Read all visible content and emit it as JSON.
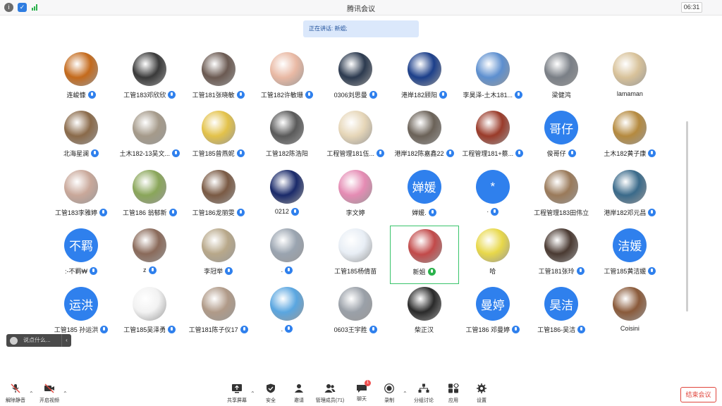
{
  "window": {
    "title": "腾讯会议",
    "clock": "06:31"
  },
  "speaking": {
    "text": "正在讲话: 新姐;"
  },
  "participants": [
    {
      "name": "连峻慷",
      "avatar_color": "#c46a1c",
      "avatar_text": "",
      "mic": "blue"
    },
    {
      "name": "工管183邓欣欣",
      "avatar_color": "#3a3a3a",
      "avatar_text": "",
      "mic": "blue"
    },
    {
      "name": "工管181张晓敏",
      "avatar_color": "#6b5a52",
      "avatar_text": "",
      "mic": "blue"
    },
    {
      "name": "工管182许敏珊",
      "avatar_color": "#e9b9a4",
      "avatar_text": "",
      "mic": "blue"
    },
    {
      "name": "0306刘思曼",
      "avatar_color": "#2c3a4f",
      "avatar_text": "",
      "mic": "blue"
    },
    {
      "name": "港岸182顾阳",
      "avatar_color": "#1c3f8a",
      "avatar_text": "",
      "mic": "blue"
    },
    {
      "name": "李昊泽-土木181...",
      "avatar_color": "#5d8fcf",
      "avatar_text": "",
      "mic": "blue"
    },
    {
      "name": "梁健鸿",
      "avatar_color": "#7a7f86",
      "avatar_text": "",
      "mic": "none"
    },
    {
      "name": "lamaman",
      "avatar_color": "#d8c29a",
      "avatar_text": "",
      "mic": "none"
    },
    {
      "name": "北海星澜",
      "avatar_color": "#8a6a4a",
      "avatar_text": "",
      "mic": "blue"
    },
    {
      "name": "土木182-13吴文...",
      "avatar_color": "#a59a8a",
      "avatar_text": "",
      "mic": "blue"
    },
    {
      "name": "工管185曾燕妮",
      "avatar_color": "#e3c24a",
      "avatar_text": "",
      "mic": "blue"
    },
    {
      "name": "工管182陈浩阳",
      "avatar_color": "#5a5a5a",
      "avatar_text": "",
      "mic": "none"
    },
    {
      "name": "工程管理181伍...",
      "avatar_color": "#e6d6b8",
      "avatar_text": "",
      "mic": "blue"
    },
    {
      "name": "港岸182陈嘉鑫22",
      "avatar_color": "#6b6258",
      "avatar_text": "",
      "mic": "blue"
    },
    {
      "name": "工程管理181+蔡...",
      "avatar_color": "#9a3b2a",
      "avatar_text": "",
      "mic": "blue"
    },
    {
      "name": "俊哥仔",
      "avatar_color": "#2f80ed",
      "avatar_text": "哥仔",
      "mic": "blue"
    },
    {
      "name": "土木182黄子康",
      "avatar_color": "#b58a3f",
      "avatar_text": "",
      "mic": "blue"
    },
    {
      "name": "工管183李雅婷",
      "avatar_color": "#c9a89a",
      "avatar_text": "",
      "mic": "blue"
    },
    {
      "name": "工管186 翁郁新",
      "avatar_color": "#8aa65a",
      "avatar_text": "",
      "mic": "blue"
    },
    {
      "name": "工管186龙丽雯",
      "avatar_color": "#7a5a44",
      "avatar_text": "",
      "mic": "blue"
    },
    {
      "name": "0212",
      "avatar_color": "#1a2a6a",
      "avatar_text": "",
      "mic": "blue"
    },
    {
      "name": "李文婷",
      "avatar_color": "#e58cb4",
      "avatar_text": "",
      "mic": "none"
    },
    {
      "name": "婵媛.",
      "avatar_color": "#2f80ed",
      "avatar_text": "婵媛",
      "mic": "blue"
    },
    {
      "name": "·",
      "avatar_color": "#2f80ed",
      "avatar_text": "*",
      "mic": "blue"
    },
    {
      "name": "工程管理183田伟立",
      "avatar_color": "#9a7a5a",
      "avatar_text": "",
      "mic": "none"
    },
    {
      "name": "港岸182邓元昌",
      "avatar_color": "#3a6a8a",
      "avatar_text": "",
      "mic": "blue"
    },
    {
      "name": ":-不羁₩",
      "avatar_color": "#2f80ed",
      "avatar_text": "不羁",
      "mic": "blue"
    },
    {
      "name": "z",
      "avatar_color": "#8a6a5a",
      "avatar_text": "",
      "mic": "blue"
    },
    {
      "name": "李冠举",
      "avatar_color": "#b8a88a",
      "avatar_text": "",
      "mic": "blue"
    },
    {
      "name": ".",
      "avatar_color": "#9aa4b0",
      "avatar_text": "",
      "mic": "blue"
    },
    {
      "name": "工管185杨倩苗",
      "avatar_color": "#e8eef5",
      "avatar_text": "",
      "mic": "none"
    },
    {
      "name": "新姐",
      "avatar_color": "#c24a4a",
      "avatar_text": "",
      "mic": "green"
    },
    {
      "name": "哈",
      "avatar_color": "#e8d84a",
      "avatar_text": "",
      "mic": "none"
    },
    {
      "name": "工管181张玲",
      "avatar_color": "#4a3a32",
      "avatar_text": "",
      "mic": "blue"
    },
    {
      "name": "工管185黄洁媛",
      "avatar_color": "#2f80ed",
      "avatar_text": "洁媛",
      "mic": "blue"
    },
    {
      "name": "工管185 孙运洪",
      "avatar_color": "#2f80ed",
      "avatar_text": "运洪",
      "mic": "blue"
    },
    {
      "name": "工管185吴泽勇",
      "avatar_color": "#f2f2f2",
      "avatar_text": "",
      "mic": "blue"
    },
    {
      "name": "工管181陈子仪17",
      "avatar_color": "#b09a88",
      "avatar_text": "",
      "mic": "blue"
    },
    {
      "name": ".",
      "avatar_color": "#5aa6e0",
      "avatar_text": "",
      "mic": "blue"
    },
    {
      "name": "0603王宇胜",
      "avatar_color": "#9aa0a8",
      "avatar_text": "",
      "mic": "blue"
    },
    {
      "name": "柴正汉",
      "avatar_color": "#2a2a2a",
      "avatar_text": "",
      "mic": "none"
    },
    {
      "name": "工管186 邓曼婷",
      "avatar_color": "#2f80ed",
      "avatar_text": "曼婷",
      "mic": "blue"
    },
    {
      "name": "工管186-吴洁",
      "avatar_color": "#2f80ed",
      "avatar_text": "昊洁",
      "mic": "blue"
    },
    {
      "name": "Coisini",
      "avatar_color": "#8a5a3a",
      "avatar_text": "",
      "mic": "none"
    }
  ],
  "active_speaker_index": 32,
  "chat": {
    "placeholder": "说点什么...",
    "arrow": "‹"
  },
  "toolbar": {
    "mute": "解除静音",
    "video": "开启视频",
    "share": "共享屏幕",
    "security": "安全",
    "invite": "邀请",
    "members": "管理成员(71)",
    "chat": "聊天",
    "chat_badge": "1",
    "record": "录制",
    "breakout": "分组讨论",
    "apps": "应用",
    "settings": "设置",
    "end": "结束会议"
  }
}
